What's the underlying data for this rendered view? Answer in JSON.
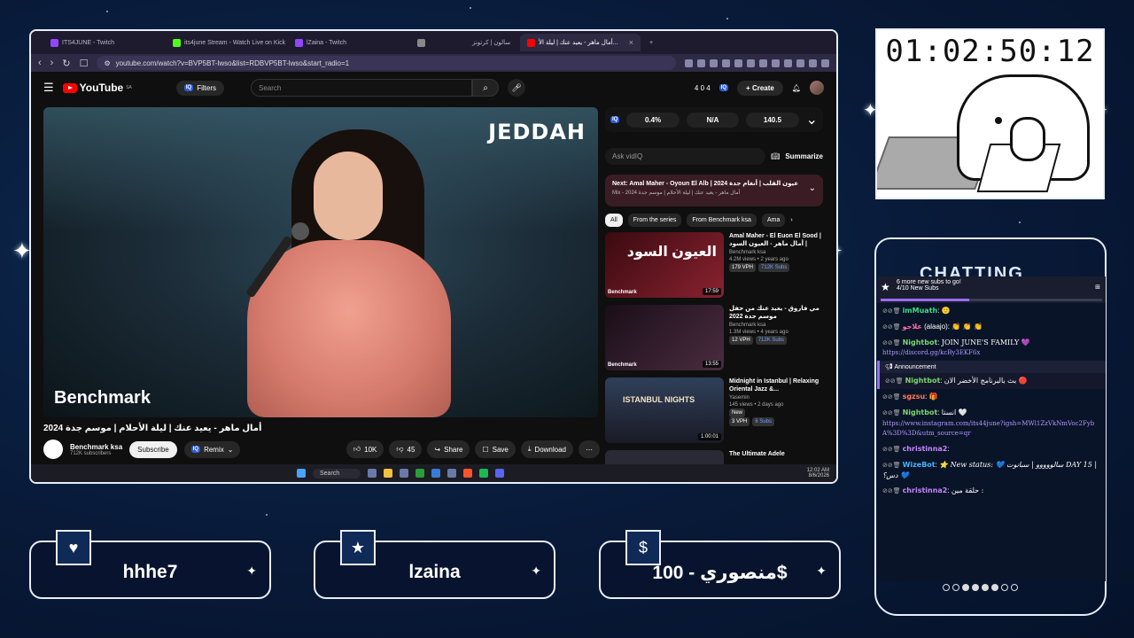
{
  "browser": {
    "tabs": [
      {
        "label": "ITS4JUNE - Twitch",
        "color": "#9146ff"
      },
      {
        "label": "its4june Stream - Watch Live on Kick",
        "color": "#53fc18"
      },
      {
        "label": "lZaina - Twitch",
        "color": "#9146ff"
      },
      {
        "label": "",
        "color": "#888888"
      },
      {
        "label": "سالون | كرتونز",
        "color": "#888888"
      },
      {
        "label": "أمال ماهر - يعيد عنك | ليلة الأ...",
        "color": "#ff0000"
      }
    ],
    "url": "youtube.com/watch?v=BVP5BT-lwso&list=RDBVP5BT-lwso&start_radio=1"
  },
  "youtube": {
    "logo": "YouTube",
    "region": "SA",
    "filters": "Filters",
    "search_placeholder": "Search",
    "counters": "4  0  4",
    "create": "Create",
    "video": {
      "watermark_top": "JEDDAH",
      "watermark_bottom": "Benchmark",
      "title": "أمال ماهر - يعيد عنك | ليلة الأحلام | موسم جدة 2024",
      "channel": "Benchmark ksa",
      "subscribers": "712K subscribers",
      "subscribe": "Subscribe",
      "remix": "Remix",
      "likes": "10K",
      "dislikes": "45",
      "share": "Share",
      "save": "Save",
      "download": "Download"
    },
    "vidiq": {
      "stats": [
        "0.4%",
        "N/A",
        "140.5"
      ],
      "ask_placeholder": "Ask vidIQ",
      "summarize": "Summarize"
    },
    "next": {
      "title": "Next: Amal Maher - Oyoun El Alb | عيون القلب | أنغام جدة 2024",
      "sub": "Mix - أمال ماهر - يعيد عنك | ليلة الأحلام | موسم جدة 2024"
    },
    "chips": [
      "All",
      "From the series",
      "From Benchmark ksa",
      "Ama"
    ],
    "related": [
      {
        "title": "Amal Maher - El Euon El Sood | أمال ماهر - العيون السود |",
        "channel": "Benchmark ksa",
        "meta": "4.2M views • 2 years ago",
        "vph": "179 VPH",
        "subs": "712K Subs",
        "duration": "17:59",
        "thumb_text": "العيون السود",
        "thumb_color": "#7a1a22"
      },
      {
        "title": "مي فاروق - يعيد عنك من حفل موسم جدة 2022",
        "channel": "Benchmark ksa",
        "meta": "1.3M views • 4 years ago",
        "vph": "12 VPH",
        "subs": "712K Subs",
        "duration": "13:55",
        "thumb_text": "",
        "thumb_color": "#3a1d2c"
      },
      {
        "title": "Midnight in Istanbul | Relaxing Oriental Jazz &...",
        "channel": "Yasemin",
        "meta": "145 views • 2 days ago",
        "vph": "3 VPH",
        "subs": "6 Subs",
        "duration": "1:00:01",
        "thumb_text": "ISTANBUL NIGHTS",
        "thumb_color": "#2a3144",
        "new": "New"
      },
      {
        "title": "The Ultimate Adele",
        "channel": "",
        "meta": "",
        "vph": "",
        "subs": "",
        "duration": "",
        "thumb_text": "",
        "thumb_color": "#333344"
      }
    ]
  },
  "taskbar": {
    "search": "Search",
    "time": "12:02 AM",
    "date": "8/6/2026"
  },
  "timer": {
    "value": "01:02:50:12"
  },
  "chat": {
    "title": "CHATTING",
    "goal_text": "6 more new subs to go!",
    "goal_count": "4/10 New Subs",
    "goal_progress": 0.4,
    "announcement_label": "Announcement",
    "messages": [
      {
        "user": "imMuath",
        "color": "#3ddc84",
        "text": "🙂"
      },
      {
        "user": "علاجو",
        "color": "#ff6fb0",
        "suffix": "(alaajo):",
        "text": "👏 👏 👏"
      },
      {
        "user": "Nightbot",
        "color": "#7cd66e",
        "text": "JOIN JUNE'S FAMILY 💜",
        "link": "https://discord.gg/kcBy3EKF6x"
      },
      {
        "user": "Nightbot",
        "color": "#7cd66e",
        "text": "بث بالبرنامج الأخضر الان 🔴",
        "announce": true
      },
      {
        "user": "sgzsu",
        "color": "#ff7a5c",
        "text": "🎁"
      },
      {
        "user": "Nightbot",
        "color": "#7cd66e",
        "text": "انستا 🤍",
        "link": "https://www.instagram.com/its44june?igsh=MWl1ZzVkNmVoc2FybA%3D%3D&utm_source=qr"
      },
      {
        "user": "christinna2",
        "color": "#c287ff",
        "text": ""
      },
      {
        "user": "WizeBot",
        "color": "#46b3ff",
        "text": "⭐ New status: 💙 سالووووو | سبانوت DAY 15 | دس؟ 💙"
      },
      {
        "user": "christinna2",
        "color": "#c287ff",
        "text": "حلقة مين :"
      }
    ]
  },
  "plates": [
    {
      "icon": "heart-icon",
      "glyph": "♥",
      "text": "hhhe7"
    },
    {
      "icon": "star-icon",
      "glyph": "★",
      "text": "lzaina"
    },
    {
      "icon": "dollar-icon",
      "glyph": "$",
      "text": "منصوري - 100$"
    }
  ]
}
